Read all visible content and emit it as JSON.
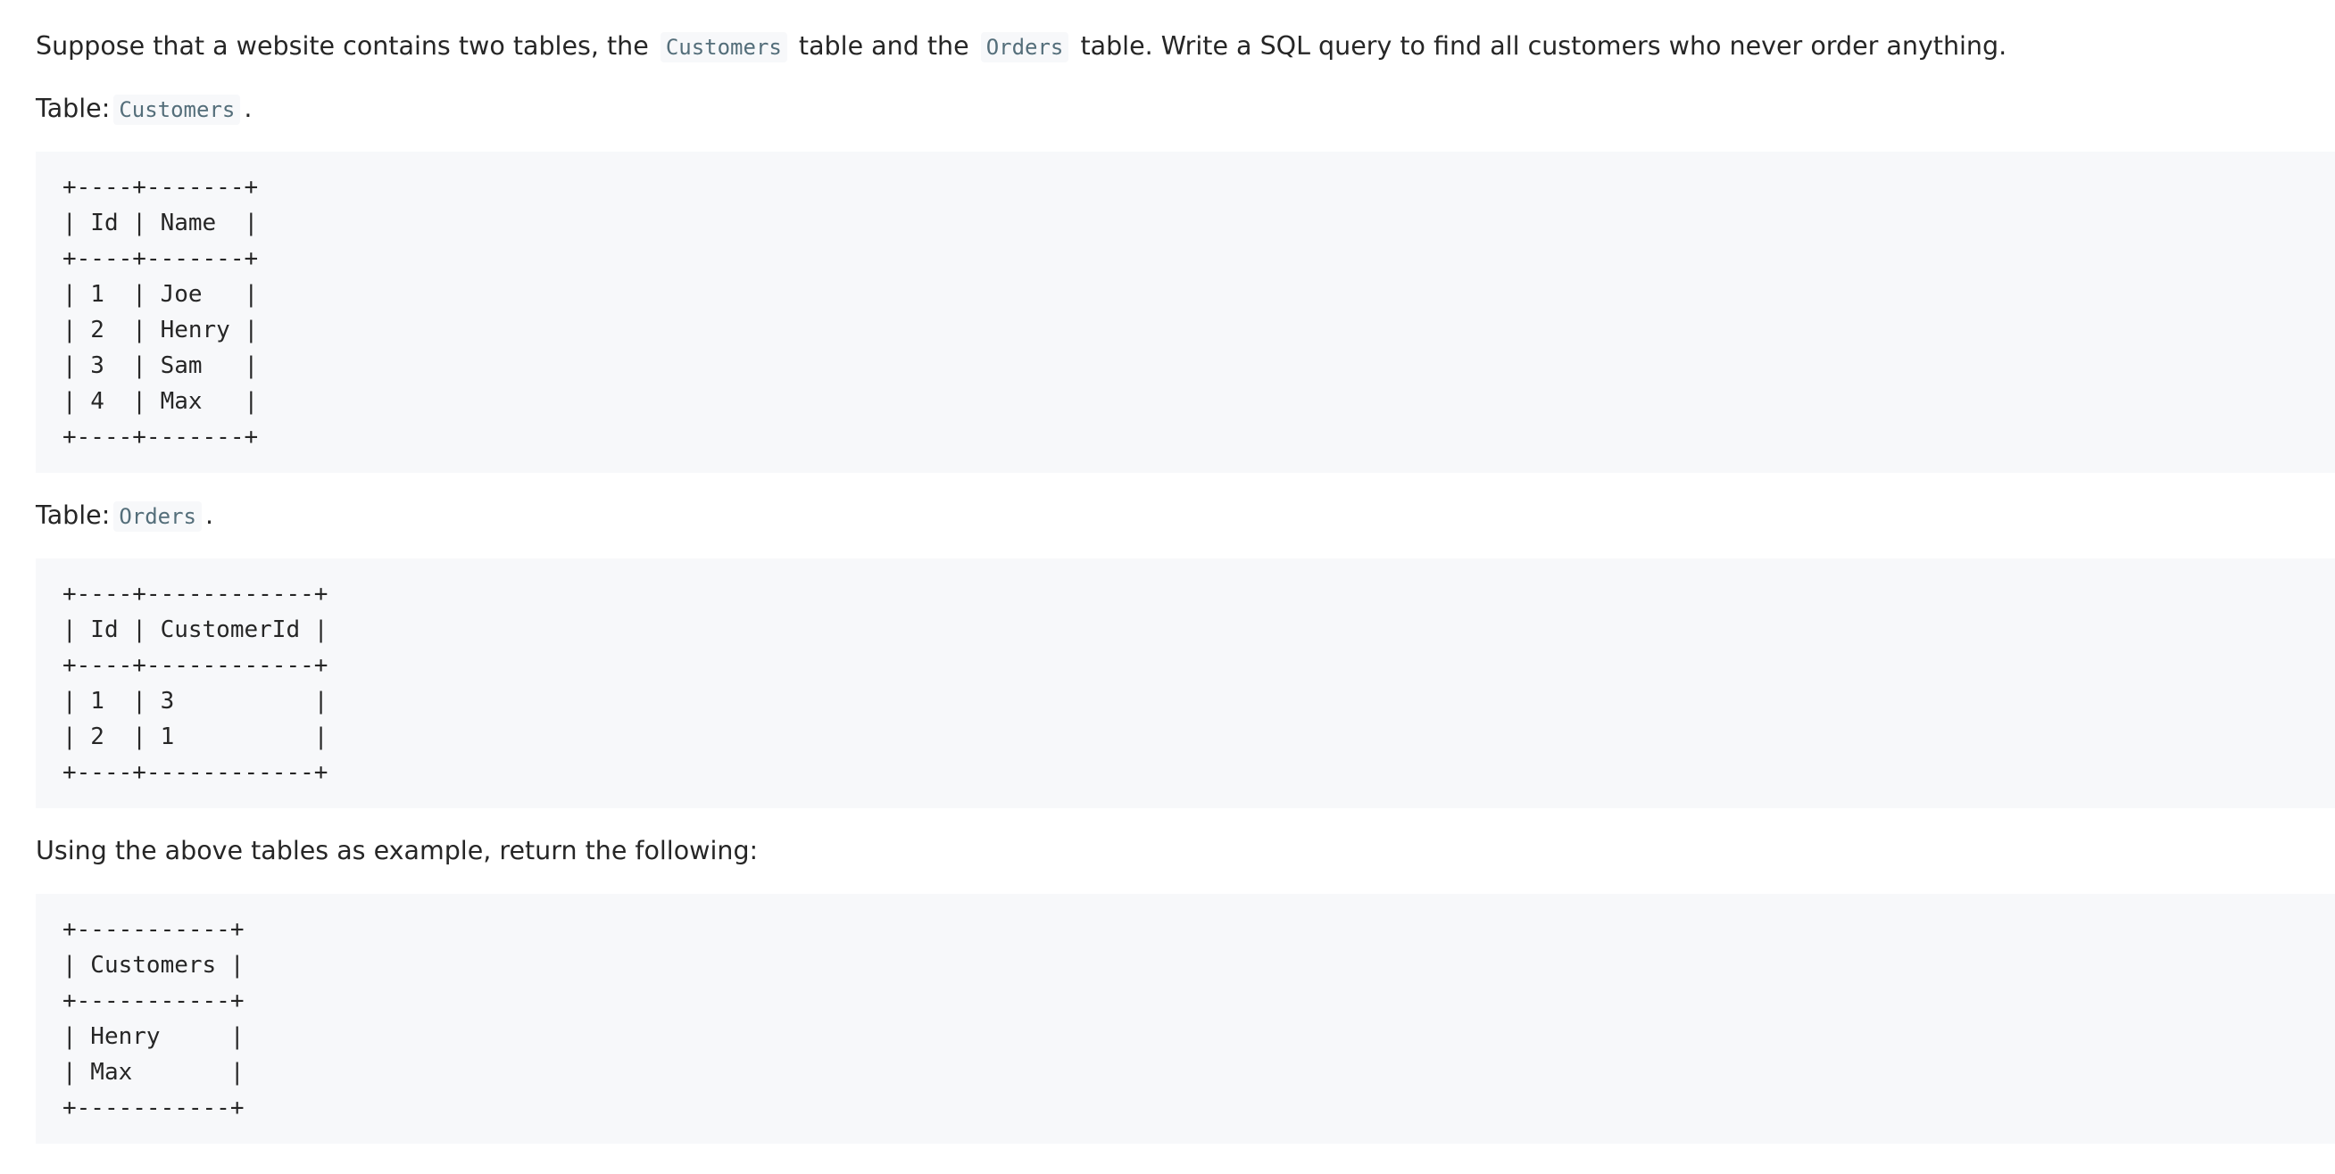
{
  "intro": {
    "text_1": "Suppose that a website contains two tables, the",
    "code_1": "Customers",
    "text_2": "table and the",
    "code_2": "Orders",
    "text_3": "table. Write a SQL query to find all customers who never order anything."
  },
  "customers_label": {
    "prefix": "Table:",
    "code": "Customers",
    "suffix": "."
  },
  "customers_table_lines": [
    "+----+-------+",
    "| Id | Name  |",
    "+----+-------+",
    "| 1  | Joe   |",
    "| 2  | Henry |",
    "| 3  | Sam   |",
    "| 4  | Max   |",
    "+----+-------+"
  ],
  "orders_label": {
    "prefix": "Table:",
    "code": "Orders",
    "suffix": "."
  },
  "orders_table_lines": [
    "+----+------------+",
    "| Id | CustomerId |",
    "+----+------------+",
    "| 1  | 3          |",
    "| 2  | 1          |",
    "+----+------------+"
  ],
  "example_text": "Using the above tables as example, return the following:",
  "result_table_lines": [
    "+-----------+",
    "| Customers |",
    "+-----------+",
    "| Henry     |",
    "| Max       |",
    "+-----------+"
  ]
}
